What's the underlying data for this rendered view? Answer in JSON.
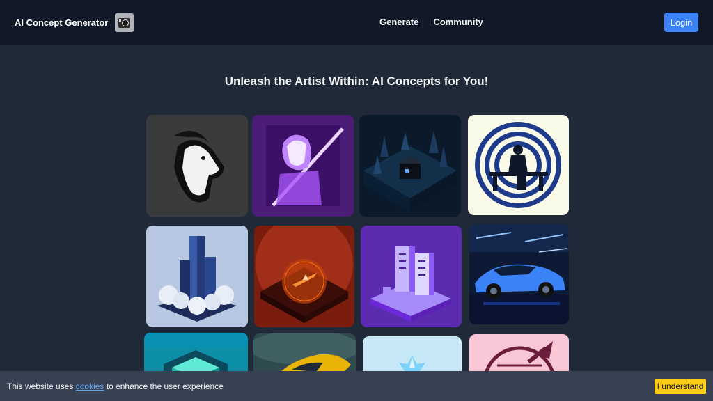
{
  "nav": {
    "brand": "AI Concept Generator",
    "links": [
      "Generate",
      "Community"
    ],
    "login": "Login"
  },
  "main": {
    "headline": "Unleash the Artist Within: AI Concepts for You!"
  },
  "gallery": {
    "tiles": [
      {
        "name": "tile-goat",
        "subject": "goat head logo"
      },
      {
        "name": "tile-anime-swordsman",
        "subject": "anime swordsman"
      },
      {
        "name": "tile-isometric-forest-house",
        "subject": "isometric forest house"
      },
      {
        "name": "tile-maze-figure",
        "subject": "maze seated figure"
      },
      {
        "name": "tile-isometric-skyscraper",
        "subject": "isometric skyscraper in clouds"
      },
      {
        "name": "tile-spaceship-planet",
        "subject": "spaceship over red planet"
      },
      {
        "name": "tile-server-racks",
        "subject": "purple server racks"
      },
      {
        "name": "tile-sports-car",
        "subject": "blue sports car"
      },
      {
        "name": "tile-teal-cube",
        "subject": "teal cube icon"
      },
      {
        "name": "tile-golden-car",
        "subject": "golden car"
      },
      {
        "name": "tile-crystal",
        "subject": "ice crystal"
      },
      {
        "name": "tile-rocket-badge",
        "subject": "rocket badge"
      }
    ]
  },
  "cookie": {
    "text_before": "This website uses ",
    "link": "cookies",
    "text_after": " to enhance the user experience",
    "button": "I understand"
  },
  "colors": {
    "navbar_bg": "#111827",
    "page_bg": "#1f2937",
    "accent": "#3b82f6",
    "cookie_button": "#facc15"
  }
}
